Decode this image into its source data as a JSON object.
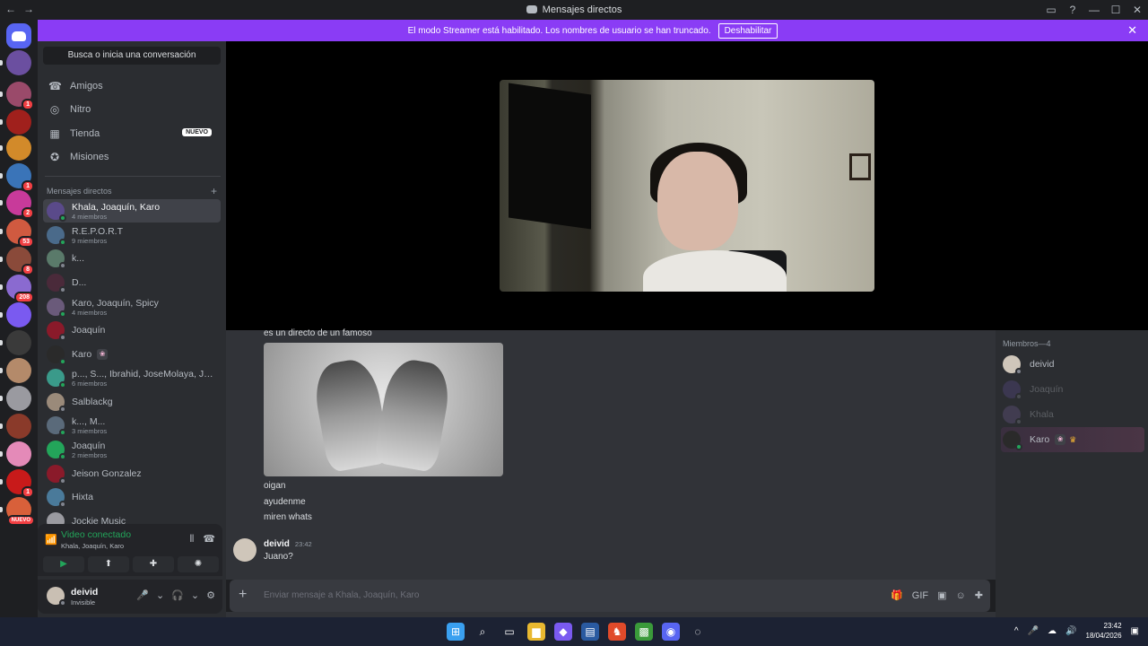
{
  "window": {
    "title": "Mensajes directos",
    "nav_back": "←",
    "nav_forward": "→",
    "controls": [
      "▭",
      "?",
      "—",
      "☐",
      "✕"
    ]
  },
  "banner": {
    "text": "El modo Streamer está habilitado. Los nombres de usuario se han truncado.",
    "button": "Deshabilitar",
    "close": "✕"
  },
  "servers": [
    {
      "color": "#6b4fa0",
      "badge": ""
    },
    {
      "color": "#9a4a6a",
      "badge": "1"
    },
    {
      "color": "#a0201c",
      "badge": ""
    },
    {
      "color": "#d28a2a",
      "badge": ""
    },
    {
      "color": "#3a74b8",
      "badge": "1"
    },
    {
      "color": "#c83a9a",
      "badge": "2"
    },
    {
      "color": "#d05a40",
      "badge": "53"
    },
    {
      "color": "#8a4a3a",
      "badge": "8"
    },
    {
      "color": "#8a6ad0",
      "badge": "208"
    },
    {
      "color": "#7a5af0",
      "badge": ""
    },
    {
      "color": "#3a3a3a",
      "badge": ""
    },
    {
      "color": "#b48a6a",
      "badge": ""
    },
    {
      "color": "#9a9aa0",
      "badge": ""
    },
    {
      "color": "#8a3a2a",
      "badge": ""
    },
    {
      "color": "#e48ab8",
      "badge": ""
    },
    {
      "color": "#c81a1a",
      "badge": "1"
    },
    {
      "color": "#d8603a",
      "badge": "NUEVO"
    }
  ],
  "sidebar": {
    "search": "Busca o inicia una conversación",
    "nav": [
      {
        "icon": "☎",
        "label": "Amigos",
        "badge": ""
      },
      {
        "icon": "◎",
        "label": "Nitro",
        "badge": ""
      },
      {
        "icon": "▦",
        "label": "Tienda",
        "badge": "NUEVO"
      },
      {
        "icon": "✪",
        "label": "Misiones",
        "badge": ""
      }
    ],
    "dm_header": "Mensajes directos",
    "dm_add": "+",
    "dms": [
      {
        "name": "Khala, Joaquín, Karo",
        "sub": "4 miembros",
        "color": "#5a4a8a",
        "status": "#23a55a",
        "tag": ""
      },
      {
        "name": "R.E.P.O.R.T",
        "sub": "9 miembros",
        "color": "#4a6a8a",
        "status": "#23a55a",
        "tag": ""
      },
      {
        "name": "k...",
        "sub": "",
        "color": "#5a7a6a",
        "status": "#80848e",
        "tag": ""
      },
      {
        "name": "D...",
        "sub": "",
        "color": "#4a2a3a",
        "status": "#80848e",
        "tag": ""
      },
      {
        "name": "Karo, Joaquín, Spicy",
        "sub": "4 miembros",
        "color": "#6a5a7a",
        "status": "#23a55a",
        "tag": ""
      },
      {
        "name": "Joaquín",
        "sub": "",
        "color": "#8a1a2a",
        "status": "#80848e",
        "tag": ""
      },
      {
        "name": "Karo",
        "sub": "",
        "color": "#2a2a2a",
        "status": "#23a55a",
        "tag": "❀"
      },
      {
        "name": "p..., S..., Ibrahid, JoseMolaya, Jud...",
        "sub": "6 miembros",
        "color": "#3a9a8a",
        "status": "#23a55a",
        "tag": ""
      },
      {
        "name": "Salblackg",
        "sub": "",
        "color": "#9a8a7a",
        "status": "#80848e",
        "tag": ""
      },
      {
        "name": "k..., M...",
        "sub": "3 miembros",
        "color": "#5a6a7a",
        "status": "#23a55a",
        "tag": ""
      },
      {
        "name": "Joaquín",
        "sub": "2 miembros",
        "color": "#23a55a",
        "status": "#23a55a",
        "tag": ""
      },
      {
        "name": "Jeison Gonzalez",
        "sub": "",
        "color": "#8a1a2a",
        "status": "#80848e",
        "tag": ""
      },
      {
        "name": "Hixta",
        "sub": "",
        "color": "#4a7a9a",
        "status": "#80848e",
        "tag": ""
      },
      {
        "name": "Jockie Music",
        "sub": "",
        "color": "#9a9aa0",
        "status": "#80848e",
        "tag": ""
      }
    ]
  },
  "voice": {
    "status": "Video conectado",
    "channel": "Khala, Joaquín, Karo",
    "buttons": [
      "▶",
      "⬆",
      "✚",
      "✺"
    ]
  },
  "user": {
    "name": "deivid",
    "status": "Invisible",
    "icons": [
      "🎤",
      "⌄",
      "🎧",
      "⌄",
      "⚙"
    ]
  },
  "chat": {
    "lines_top": [
      "es un directo de un famoso"
    ],
    "lines_mid": [
      "oigan",
      "ayudenme",
      "miren whats"
    ],
    "author": "deivid",
    "time": "23:42",
    "last_message": "Juano?",
    "composer_placeholder": "Enviar mensaje a Khala, Joaquín, Karo",
    "composer_icons": [
      "🎁",
      "GIF",
      "▣",
      "☺",
      "✚"
    ]
  },
  "members": {
    "header": "Miembros—4",
    "list": [
      {
        "name": "deivid",
        "color": "#cfc6ba",
        "status": "#80848e",
        "dim": false,
        "tag": "",
        "crown": ""
      },
      {
        "name": "Joaquín",
        "color": "#5a4a8a",
        "status": "#80848e",
        "dim": true,
        "tag": "",
        "crown": ""
      },
      {
        "name": "Khala",
        "color": "#6a5a8a",
        "status": "#80848e",
        "dim": true,
        "tag": "",
        "crown": ""
      },
      {
        "name": "Karo",
        "color": "#2a2a2a",
        "status": "#23a55a",
        "dim": false,
        "tag": "❀",
        "crown": "♛"
      }
    ]
  },
  "taskbar": {
    "apps": [
      "⊞",
      "⌕",
      "▭",
      "▆",
      "◆",
      "▤",
      "♞",
      "▩",
      "◉",
      "◌"
    ],
    "time": "23:42",
    "date": "18/04/2026",
    "tray": [
      "^",
      "🎤",
      "☁",
      "🔊"
    ]
  }
}
